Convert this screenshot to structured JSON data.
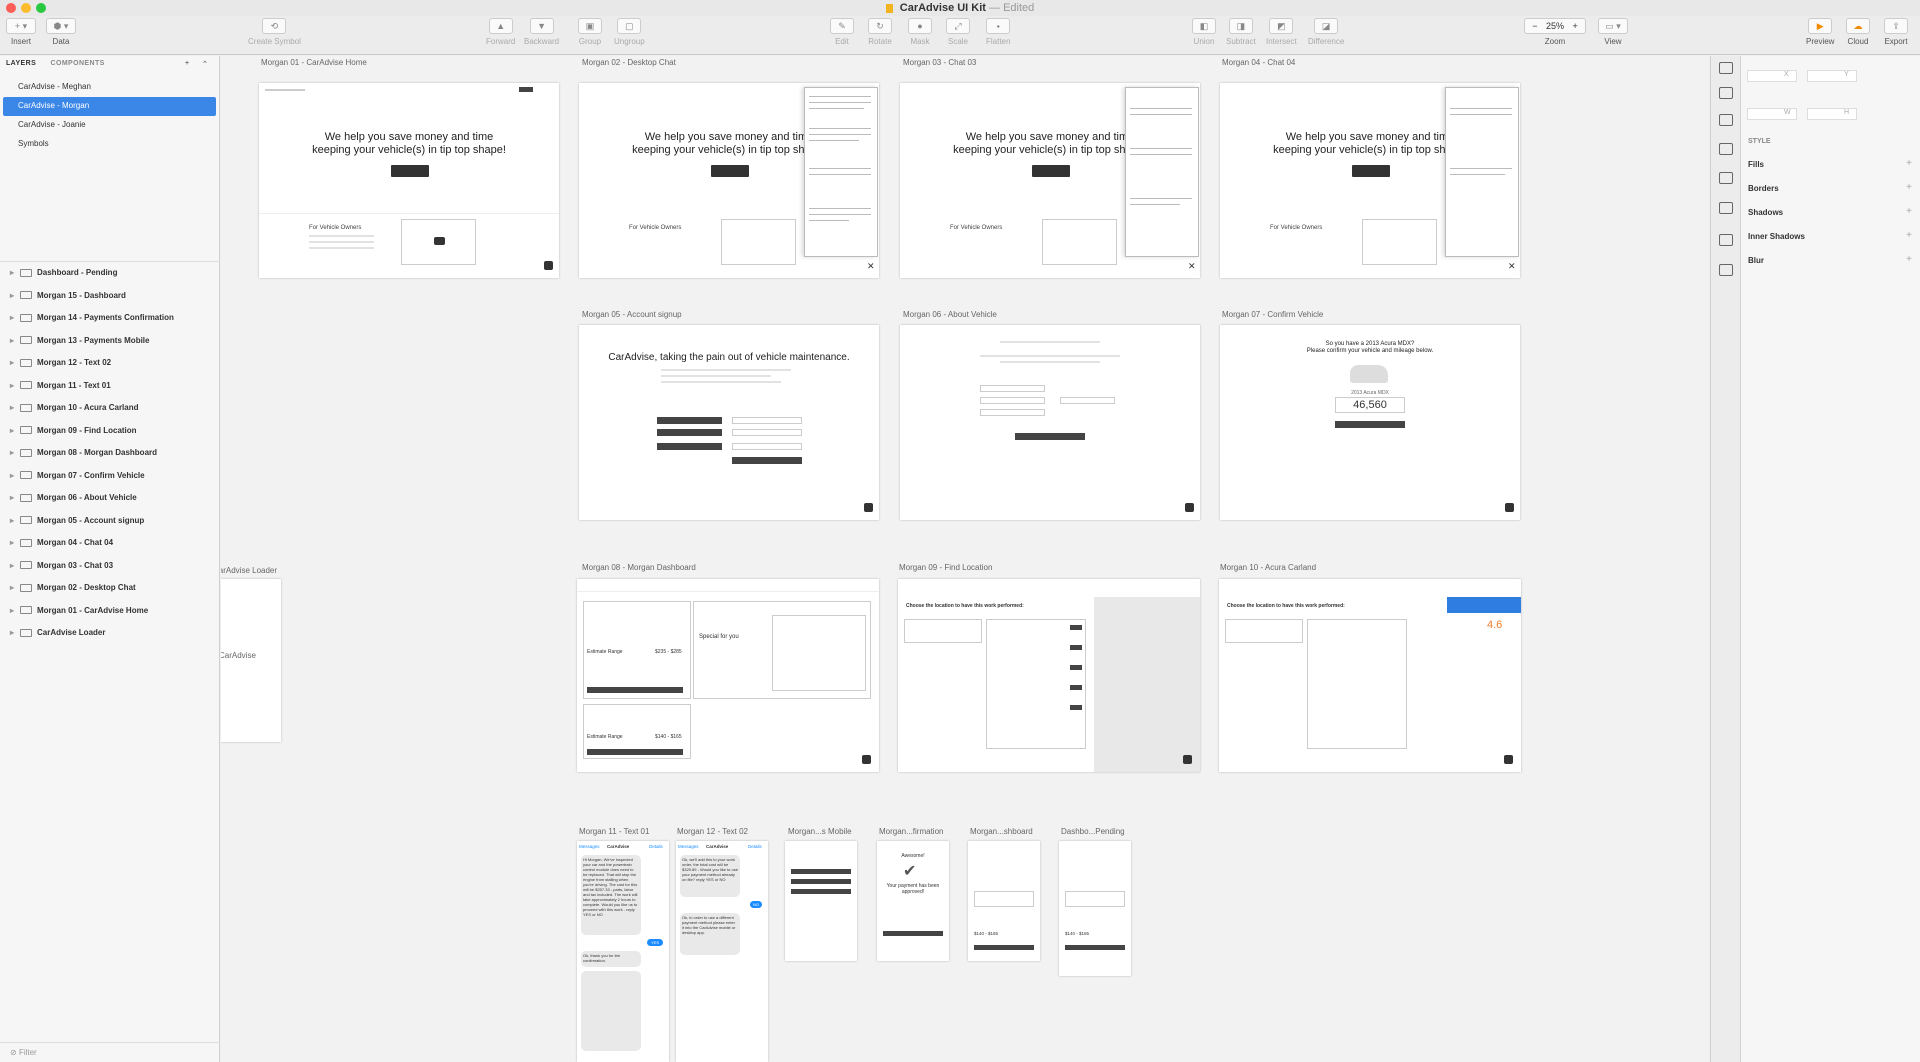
{
  "window": {
    "title": "CarAdvise UI Kit",
    "edited_label": "— Edited"
  },
  "toolbar": {
    "insert": "Insert",
    "data": "Data",
    "create_symbol": "Create Symbol",
    "forward": "Forward",
    "backward": "Backward",
    "group": "Group",
    "ungroup": "Ungroup",
    "edit": "Edit",
    "rotate": "Rotate",
    "mask": "Mask",
    "scale": "Scale",
    "flatten": "Flatten",
    "union": "Union",
    "subtract": "Subtract",
    "intersect": "Intersect",
    "difference": "Difference",
    "zoom_label": "Zoom",
    "zoom_value": "25%",
    "zoom_minus": "−",
    "zoom_plus": "+",
    "view": "View",
    "preview": "Preview",
    "cloud": "Cloud",
    "export": "Export"
  },
  "sidebar": {
    "tab_layers": "LAYERS",
    "tab_components": "COMPONENTS",
    "add": "+",
    "collapse": "⌃",
    "pages": [
      {
        "label": "CarAdvise - Meghan",
        "selected": false
      },
      {
        "label": "CarAdvise - Morgan",
        "selected": true
      },
      {
        "label": "CarAdvise - Joanie",
        "selected": false
      },
      {
        "label": "Symbols",
        "selected": false
      }
    ],
    "artboards": [
      "Dashboard - Pending",
      "Morgan 15 - Dashboard",
      "Morgan 14 - Payments Confirmation",
      "Morgan 13 - Payments Mobile",
      "Morgan 12 - Text 02",
      "Morgan 11 - Text 01",
      "Morgan 10 - Acura Carland",
      "Morgan 09 - Find Location",
      "Morgan 08 - Morgan Dashboard",
      "Morgan 07 - Confirm Vehicle",
      "Morgan 06 - About Vehicle",
      "Morgan 05 - Account signup",
      "Morgan 04 - Chat 04",
      "Morgan 03 - Chat 03",
      "Morgan 02 - Desktop Chat",
      "Morgan 01 - CarAdvise Home",
      "CarAdvise Loader"
    ],
    "filter_placeholder": "Filter"
  },
  "canvas": {
    "labels": {
      "a01": "Morgan 01 - CarAdvise Home",
      "a02": "Morgan 02 - Desktop Chat",
      "a03": "Morgan 03 - Chat 03",
      "a04": "Morgan 04 - Chat 04",
      "a05": "Morgan 05 - Account signup",
      "a06": "Morgan 06 - About Vehicle",
      "a07": "Morgan 07 - Confirm Vehicle",
      "a08": "Morgan 08 - Morgan Dashboard",
      "a09": "Morgan 09 - Find Location",
      "a10": "Morgan 10 - Acura Carland",
      "loader": "CarAdvise Loader",
      "a11": "Morgan 11 - Text 01",
      "a12": "Morgan 12 - Text 02",
      "a13": "Morgan...s Mobile",
      "a14": "Morgan...firmation",
      "a15": "Morgan...shboard",
      "dash": "Dashbo...Pending"
    },
    "hero_line1": "We help you save money and time",
    "hero_line2": "keeping your vehicle(s) in tip top shape!",
    "for_owners": "For Vehicle Owners",
    "signup_title": "CarAdvise, taking the pain out of vehicle maintenance.",
    "confirm_question": "So you have a 2013 Acura MDX?",
    "confirm_sub": "Please confirm your vehicle and mileage below.",
    "confirm_vehicle": "2013 Acura MDX",
    "mileage": "46,560",
    "special_for_you": "Special for you",
    "estimate_range_1": "$235 - $285",
    "estimate_range_2": "$140 - $165",
    "estimate_label": "Estimate Range",
    "find_title": "Choose the location to have this work performed:",
    "rating": "4.6",
    "loader_logo": "CarAdvise",
    "text_payment_ok": "Awesome!",
    "text_payment_msg": "Your payment has been approved!",
    "messages_back": "Messages",
    "messages_name": "CarAdvise",
    "messages_details": "Details",
    "yes_reply": "YES",
    "no_reply": "NO",
    "chat_msg1": "Hi Morgan, We've inspected your car and the powertrain control module does need to be replaced. That will stop the engine from stalling when you're driving. The cost for this will be $257.33 - parts, labor and tax included. The work will take approximately 2 hours to complete. Would you like us to proceed with this work - reply YES or NO",
    "chat_msg2": "Ok, thank you for the confirmation.",
    "chat_msg3": "Ok, we'll add this to your work order, the total cost will be $329.89 - Would you like to use your payment method already on file? reply YES or NO",
    "chat_msg4": "Ok, in order to use a different payment method please enter it into the CarAdvise mobile or desktop app."
  },
  "inspector": {
    "style": "STYLE",
    "fills": "Fills",
    "borders": "Borders",
    "shadows": "Shadows",
    "inner_shadows": "Inner Shadows",
    "blur": "Blur",
    "x": "X",
    "y": "Y",
    "w": "W",
    "h": "H"
  },
  "colors": {
    "selection": "#3b87e7",
    "sms_blue": "#1a8cff",
    "ad_blue": "#2f7de1",
    "rating_orange": "#f07c28"
  }
}
